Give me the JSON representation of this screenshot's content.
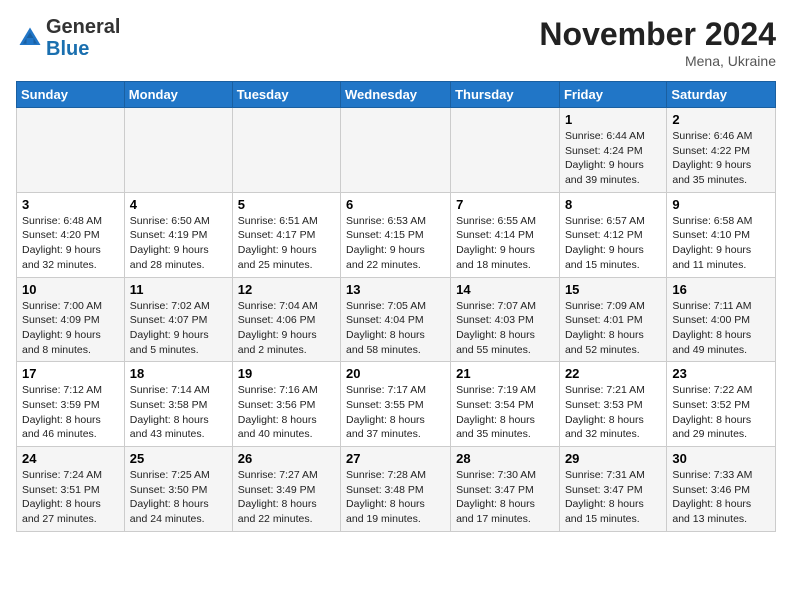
{
  "header": {
    "logo": {
      "general": "General",
      "blue": "Blue"
    },
    "title": "November 2024",
    "location": "Mena, Ukraine"
  },
  "weekdays": [
    "Sunday",
    "Monday",
    "Tuesday",
    "Wednesday",
    "Thursday",
    "Friday",
    "Saturday"
  ],
  "rows": [
    {
      "cells": [
        {
          "day": "",
          "info": ""
        },
        {
          "day": "",
          "info": ""
        },
        {
          "day": "",
          "info": ""
        },
        {
          "day": "",
          "info": ""
        },
        {
          "day": "",
          "info": ""
        },
        {
          "day": "1",
          "info": "Sunrise: 6:44 AM\nSunset: 4:24 PM\nDaylight: 9 hours\nand 39 minutes."
        },
        {
          "day": "2",
          "info": "Sunrise: 6:46 AM\nSunset: 4:22 PM\nDaylight: 9 hours\nand 35 minutes."
        }
      ]
    },
    {
      "cells": [
        {
          "day": "3",
          "info": "Sunrise: 6:48 AM\nSunset: 4:20 PM\nDaylight: 9 hours\nand 32 minutes."
        },
        {
          "day": "4",
          "info": "Sunrise: 6:50 AM\nSunset: 4:19 PM\nDaylight: 9 hours\nand 28 minutes."
        },
        {
          "day": "5",
          "info": "Sunrise: 6:51 AM\nSunset: 4:17 PM\nDaylight: 9 hours\nand 25 minutes."
        },
        {
          "day": "6",
          "info": "Sunrise: 6:53 AM\nSunset: 4:15 PM\nDaylight: 9 hours\nand 22 minutes."
        },
        {
          "day": "7",
          "info": "Sunrise: 6:55 AM\nSunset: 4:14 PM\nDaylight: 9 hours\nand 18 minutes."
        },
        {
          "day": "8",
          "info": "Sunrise: 6:57 AM\nSunset: 4:12 PM\nDaylight: 9 hours\nand 15 minutes."
        },
        {
          "day": "9",
          "info": "Sunrise: 6:58 AM\nSunset: 4:10 PM\nDaylight: 9 hours\nand 11 minutes."
        }
      ]
    },
    {
      "cells": [
        {
          "day": "10",
          "info": "Sunrise: 7:00 AM\nSunset: 4:09 PM\nDaylight: 9 hours\nand 8 minutes."
        },
        {
          "day": "11",
          "info": "Sunrise: 7:02 AM\nSunset: 4:07 PM\nDaylight: 9 hours\nand 5 minutes."
        },
        {
          "day": "12",
          "info": "Sunrise: 7:04 AM\nSunset: 4:06 PM\nDaylight: 9 hours\nand 2 minutes."
        },
        {
          "day": "13",
          "info": "Sunrise: 7:05 AM\nSunset: 4:04 PM\nDaylight: 8 hours\nand 58 minutes."
        },
        {
          "day": "14",
          "info": "Sunrise: 7:07 AM\nSunset: 4:03 PM\nDaylight: 8 hours\nand 55 minutes."
        },
        {
          "day": "15",
          "info": "Sunrise: 7:09 AM\nSunset: 4:01 PM\nDaylight: 8 hours\nand 52 minutes."
        },
        {
          "day": "16",
          "info": "Sunrise: 7:11 AM\nSunset: 4:00 PM\nDaylight: 8 hours\nand 49 minutes."
        }
      ]
    },
    {
      "cells": [
        {
          "day": "17",
          "info": "Sunrise: 7:12 AM\nSunset: 3:59 PM\nDaylight: 8 hours\nand 46 minutes."
        },
        {
          "day": "18",
          "info": "Sunrise: 7:14 AM\nSunset: 3:58 PM\nDaylight: 8 hours\nand 43 minutes."
        },
        {
          "day": "19",
          "info": "Sunrise: 7:16 AM\nSunset: 3:56 PM\nDaylight: 8 hours\nand 40 minutes."
        },
        {
          "day": "20",
          "info": "Sunrise: 7:17 AM\nSunset: 3:55 PM\nDaylight: 8 hours\nand 37 minutes."
        },
        {
          "day": "21",
          "info": "Sunrise: 7:19 AM\nSunset: 3:54 PM\nDaylight: 8 hours\nand 35 minutes."
        },
        {
          "day": "22",
          "info": "Sunrise: 7:21 AM\nSunset: 3:53 PM\nDaylight: 8 hours\nand 32 minutes."
        },
        {
          "day": "23",
          "info": "Sunrise: 7:22 AM\nSunset: 3:52 PM\nDaylight: 8 hours\nand 29 minutes."
        }
      ]
    },
    {
      "cells": [
        {
          "day": "24",
          "info": "Sunrise: 7:24 AM\nSunset: 3:51 PM\nDaylight: 8 hours\nand 27 minutes."
        },
        {
          "day": "25",
          "info": "Sunrise: 7:25 AM\nSunset: 3:50 PM\nDaylight: 8 hours\nand 24 minutes."
        },
        {
          "day": "26",
          "info": "Sunrise: 7:27 AM\nSunset: 3:49 PM\nDaylight: 8 hours\nand 22 minutes."
        },
        {
          "day": "27",
          "info": "Sunrise: 7:28 AM\nSunset: 3:48 PM\nDaylight: 8 hours\nand 19 minutes."
        },
        {
          "day": "28",
          "info": "Sunrise: 7:30 AM\nSunset: 3:47 PM\nDaylight: 8 hours\nand 17 minutes."
        },
        {
          "day": "29",
          "info": "Sunrise: 7:31 AM\nSunset: 3:47 PM\nDaylight: 8 hours\nand 15 minutes."
        },
        {
          "day": "30",
          "info": "Sunrise: 7:33 AM\nSunset: 3:46 PM\nDaylight: 8 hours\nand 13 minutes."
        }
      ]
    }
  ]
}
